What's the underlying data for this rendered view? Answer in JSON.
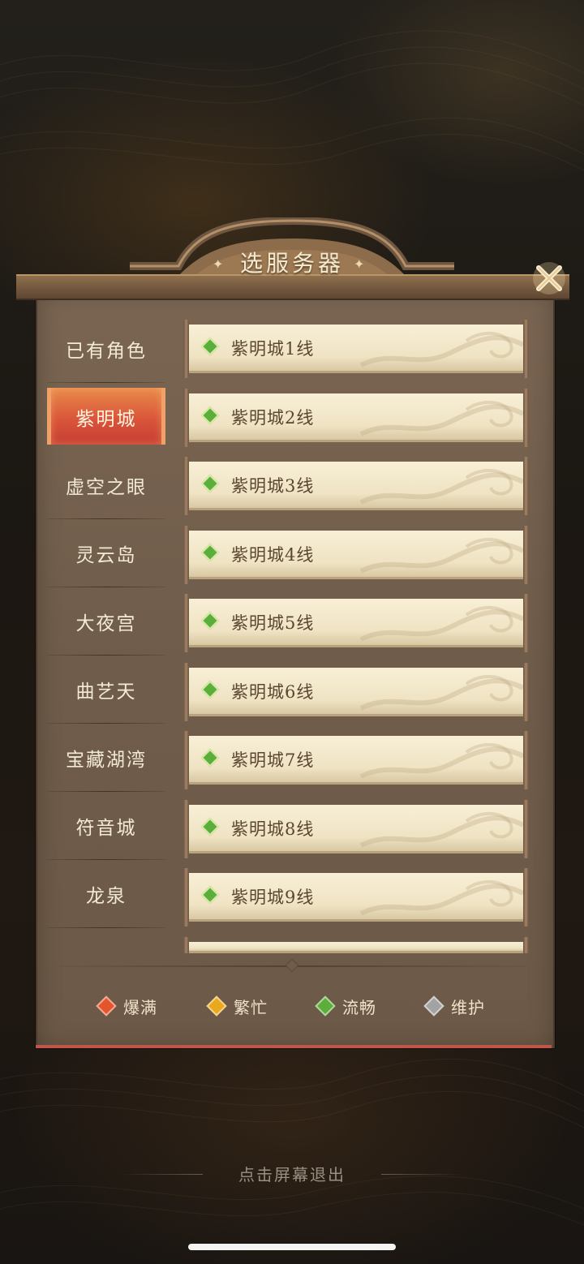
{
  "title": "选服务器",
  "regions": [
    {
      "label": "已有角色",
      "selected": false
    },
    {
      "label": "紫明城",
      "selected": true
    },
    {
      "label": "虚空之眼",
      "selected": false
    },
    {
      "label": "灵云岛",
      "selected": false
    },
    {
      "label": "大夜宫",
      "selected": false
    },
    {
      "label": "曲艺天",
      "selected": false
    },
    {
      "label": "宝藏湖湾",
      "selected": false
    },
    {
      "label": "符音城",
      "selected": false
    },
    {
      "label": "龙泉",
      "selected": false
    }
  ],
  "servers": [
    {
      "name": "紫明城1线",
      "status": "流畅"
    },
    {
      "name": "紫明城2线",
      "status": "流畅"
    },
    {
      "name": "紫明城3线",
      "status": "流畅"
    },
    {
      "name": "紫明城4线",
      "status": "流畅"
    },
    {
      "name": "紫明城5线",
      "status": "流畅"
    },
    {
      "name": "紫明城6线",
      "status": "流畅"
    },
    {
      "name": "紫明城7线",
      "status": "流畅"
    },
    {
      "name": "紫明城8线",
      "status": "流畅"
    },
    {
      "name": "紫明城9线",
      "status": "流畅"
    }
  ],
  "legend": [
    {
      "label": "爆满",
      "color": "#e5552c"
    },
    {
      "label": "繁忙",
      "color": "#e8a91f"
    },
    {
      "label": "流畅",
      "color": "#5cae3a"
    },
    {
      "label": "维护",
      "color": "#a3a3a3"
    }
  ],
  "status_colors": {
    "爆满": "#e5552c",
    "繁忙": "#e8a91f",
    "流畅": "#5cae3a",
    "维护": "#a3a3a3"
  },
  "exit_hint": "点击屏幕退出",
  "icons": {
    "close": "close-icon",
    "status": "diamond-status-icon"
  }
}
